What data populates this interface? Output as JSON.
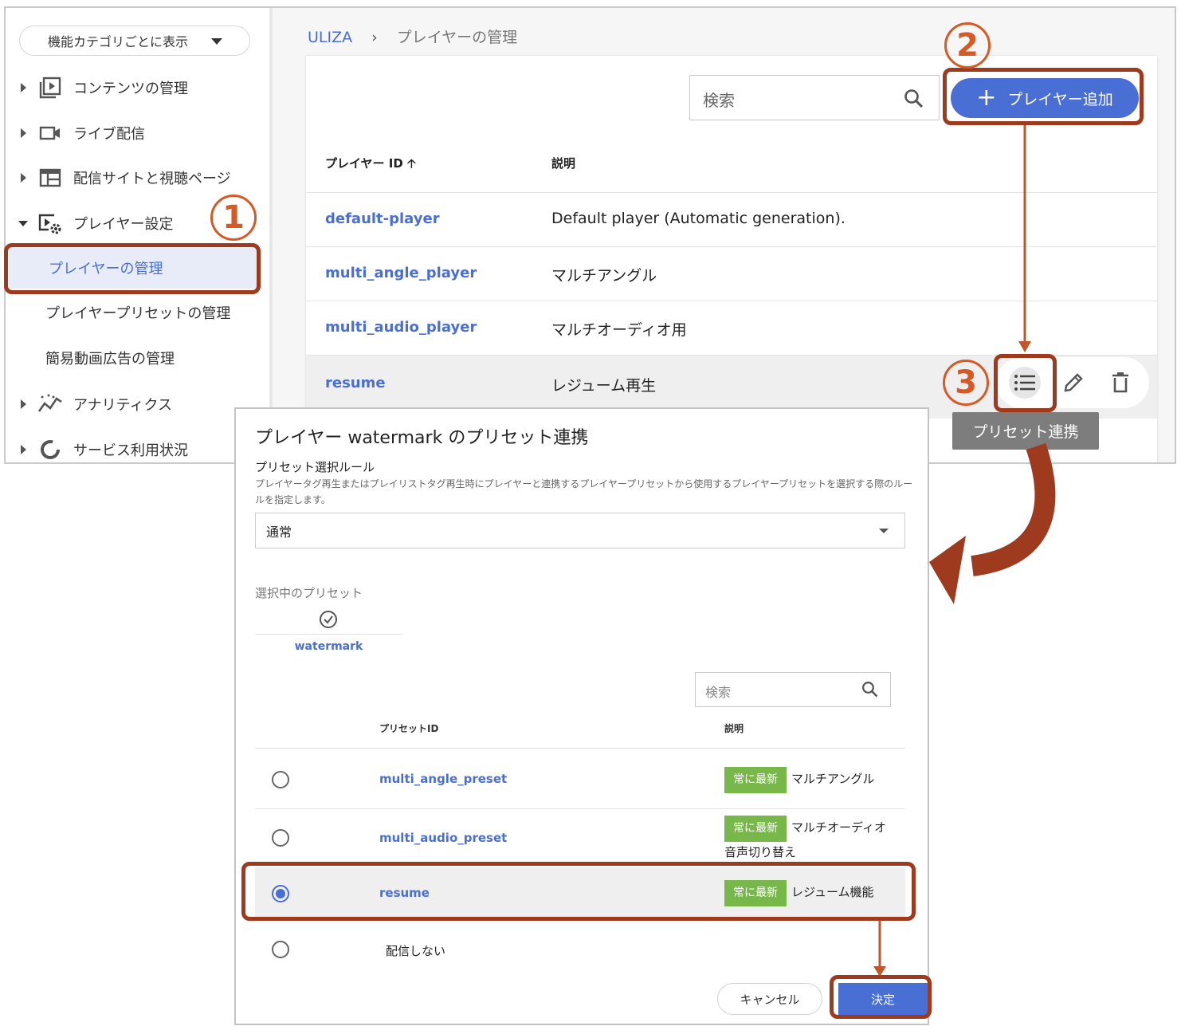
{
  "sidebar": {
    "category_select": "機能カテゴリごとに表示",
    "items": [
      {
        "label": "コンテンツの管理",
        "icon": "play-library-icon"
      },
      {
        "label": "ライブ配信",
        "icon": "video-camera-icon"
      },
      {
        "label": "配信サイトと視聴ページ",
        "icon": "web-layout-icon"
      },
      {
        "label": "プレイヤー設定",
        "icon": "player-settings-icon"
      },
      {
        "label": "アナリティクス",
        "icon": "analytics-icon"
      },
      {
        "label": "サービス利用状況",
        "icon": "usage-donut-icon"
      }
    ],
    "sub_items": [
      {
        "label": "プレイヤーの管理"
      },
      {
        "label": "プレイヤープリセットの管理"
      },
      {
        "label": "簡易動画広告の管理"
      }
    ]
  },
  "breadcrumb": {
    "root": "ULIZA",
    "sep": "›",
    "current": "プレイヤーの管理"
  },
  "toolbar": {
    "search_placeholder": "検索",
    "add_button": "プレイヤー追加",
    "add_plus": "+"
  },
  "table": {
    "headers": [
      "プレイヤー ID 🡡",
      "説明"
    ],
    "rows": [
      {
        "id": "default-player",
        "desc": "Default player (Automatic generation)."
      },
      {
        "id": "multi_angle_player",
        "desc": "マルチアングル"
      },
      {
        "id": "multi_audio_player",
        "desc": "マルチオーディオ用"
      },
      {
        "id": "resume",
        "desc": "レジューム再生"
      }
    ]
  },
  "tooltip": "プリセット連携",
  "callouts": {
    "one": "1",
    "two": "2",
    "three": "3"
  },
  "dialog": {
    "title": "プレイヤー watermark のプリセット連携",
    "rule_label": "プリセット選択ルール",
    "rule_help": "プレイヤータグ再生またはプレイリストタグ再生時にプレイヤーと連携するプレイヤープリセットから使用するプレイヤープリセットを選択する際のルールを指定します。",
    "rule_value": "通常",
    "selected_label": "選択中のプリセット",
    "selected_name": "watermark",
    "search_placeholder": "検索",
    "headers": [
      "プリセットID",
      "説明"
    ],
    "rows": [
      {
        "id": "multi_angle_preset",
        "badge": "常に最新",
        "desc": "マルチアングル",
        "selected": false
      },
      {
        "id": "multi_audio_preset",
        "badge": "常に最新",
        "desc": "マルチオーディオ音声切り替え",
        "selected": false
      },
      {
        "id": "resume",
        "badge": "常に最新",
        "desc": "レジューム機能",
        "selected": true
      },
      {
        "id": "配信しない",
        "badge": "",
        "desc": "",
        "selected": false
      }
    ],
    "cancel": "キャンセル",
    "ok": "決定"
  },
  "colors": {
    "accent": "#4a6fd4",
    "callout": "#9e3a1e",
    "badge": "#78b84a"
  }
}
